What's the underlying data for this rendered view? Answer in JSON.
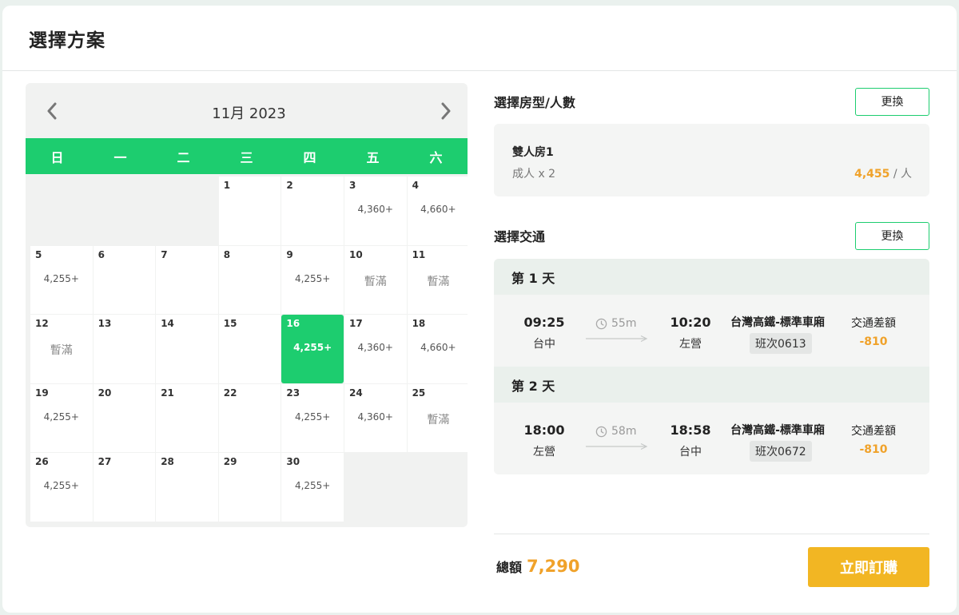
{
  "header": {
    "title": "選擇方案"
  },
  "calendar": {
    "month_label": "11月 2023",
    "weekdays": [
      "日",
      "一",
      "二",
      "三",
      "四",
      "五",
      "六"
    ],
    "days": [
      {
        "day": "",
        "price": "",
        "status": ""
      },
      {
        "day": "",
        "price": "",
        "status": ""
      },
      {
        "day": "",
        "price": "",
        "status": ""
      },
      {
        "day": "1",
        "price": "",
        "status": ""
      },
      {
        "day": "2",
        "price": "",
        "status": ""
      },
      {
        "day": "3",
        "price": "4,360+",
        "status": ""
      },
      {
        "day": "4",
        "price": "4,660+",
        "status": ""
      },
      {
        "day": "5",
        "price": "4,255+",
        "status": ""
      },
      {
        "day": "6",
        "price": "",
        "status": ""
      },
      {
        "day": "7",
        "price": "",
        "status": ""
      },
      {
        "day": "8",
        "price": "",
        "status": ""
      },
      {
        "day": "9",
        "price": "4,255+",
        "status": ""
      },
      {
        "day": "10",
        "price": "",
        "status": "暫滿"
      },
      {
        "day": "11",
        "price": "",
        "status": "暫滿"
      },
      {
        "day": "12",
        "price": "",
        "status": "暫滿"
      },
      {
        "day": "13",
        "price": "",
        "status": ""
      },
      {
        "day": "14",
        "price": "",
        "status": ""
      },
      {
        "day": "15",
        "price": "",
        "status": ""
      },
      {
        "day": "16",
        "price": "4,255+",
        "status": "",
        "selected": true
      },
      {
        "day": "17",
        "price": "4,360+",
        "status": ""
      },
      {
        "day": "18",
        "price": "4,660+",
        "status": ""
      },
      {
        "day": "19",
        "price": "4,255+",
        "status": ""
      },
      {
        "day": "20",
        "price": "",
        "status": ""
      },
      {
        "day": "21",
        "price": "",
        "status": ""
      },
      {
        "day": "22",
        "price": "",
        "status": ""
      },
      {
        "day": "23",
        "price": "4,255+",
        "status": ""
      },
      {
        "day": "24",
        "price": "4,360+",
        "status": ""
      },
      {
        "day": "25",
        "price": "",
        "status": "暫滿"
      },
      {
        "day": "26",
        "price": "4,255+",
        "status": ""
      },
      {
        "day": "27",
        "price": "",
        "status": ""
      },
      {
        "day": "28",
        "price": "",
        "status": ""
      },
      {
        "day": "29",
        "price": "",
        "status": ""
      },
      {
        "day": "30",
        "price": "4,255+",
        "status": ""
      }
    ]
  },
  "room": {
    "section_title": "選擇房型/人數",
    "change_label": "更換",
    "name": "雙人房1",
    "guests": "成人 x 2",
    "price": "4,455",
    "price_unit": " / 人"
  },
  "transport": {
    "section_title": "選擇交通",
    "change_label": "更換",
    "days": [
      {
        "label": "第 1 天",
        "depart_time": "09:25",
        "depart_station": "台中",
        "duration": "55m",
        "arrive_time": "10:20",
        "arrive_station": "左營",
        "train": "台灣高鐵-標準車廂",
        "code": "班次0613",
        "diff_label": "交通差額",
        "diff_value": "-810"
      },
      {
        "label": "第 2 天",
        "depart_time": "18:00",
        "depart_station": "左營",
        "duration": "58m",
        "arrive_time": "18:58",
        "arrive_station": "台中",
        "train": "台灣高鐵-標準車廂",
        "code": "班次0672",
        "diff_label": "交通差額",
        "diff_value": "-810"
      }
    ]
  },
  "footer": {
    "total_label": "總額",
    "total_value": "7,290",
    "buy_label": "立即訂購"
  },
  "colors": {
    "accent_green": "#1dcd6f",
    "price_orange": "#f0a22a",
    "buy_yellow": "#f2b623"
  }
}
